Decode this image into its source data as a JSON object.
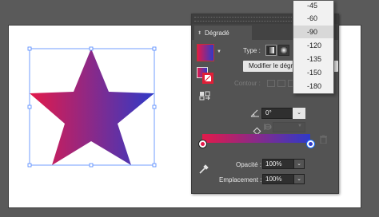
{
  "panel": {
    "tab_label": "Dégradé",
    "type_label": "Type :",
    "modify_button_label": "Modifier le dégradé",
    "contour_label": "Contour :",
    "angle_value": "0°",
    "opacity_label": "Opacité :",
    "opacity_value": "100%",
    "location_label": "Emplacement :",
    "location_value": "100%"
  },
  "gradient": {
    "start_color": "#e3194a",
    "end_color": "#2f3ac8"
  },
  "angle_dropdown": {
    "options": [
      "-45",
      "-60",
      "-90",
      "-120",
      "-135",
      "-150",
      "-180"
    ],
    "selected_index": 2
  },
  "icons": {
    "artwork": "star-shape",
    "linear": "linear-gradient-icon",
    "radial": "radial-gradient-icon",
    "angle": "angle-icon",
    "aspect": "aspect-ratio-icon",
    "eyedropper": "eyedropper-icon",
    "trash": "trash-icon"
  }
}
